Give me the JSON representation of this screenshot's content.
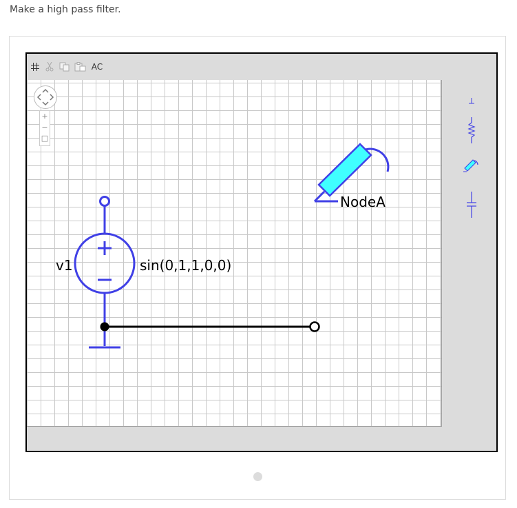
{
  "prompt": "Make a high pass filter.",
  "toolbar": {
    "ac_label": "AC",
    "icons": [
      "grid-icon",
      "cut-icon",
      "copy-icon",
      "paste-icon"
    ]
  },
  "zoom": {
    "plus": "+",
    "minus": "−",
    "fit": "□"
  },
  "schematic": {
    "source_name": "v1",
    "source_value": "sin(0,1,1,0,0)",
    "probe_label": "NodeA",
    "colors": {
      "component": "#4040e6",
      "wire": "#000000",
      "probe_fill": "#40ffff"
    }
  },
  "palette": [
    "ground-icon",
    "resistor-icon",
    "probe-icon",
    "capacitor-icon"
  ]
}
